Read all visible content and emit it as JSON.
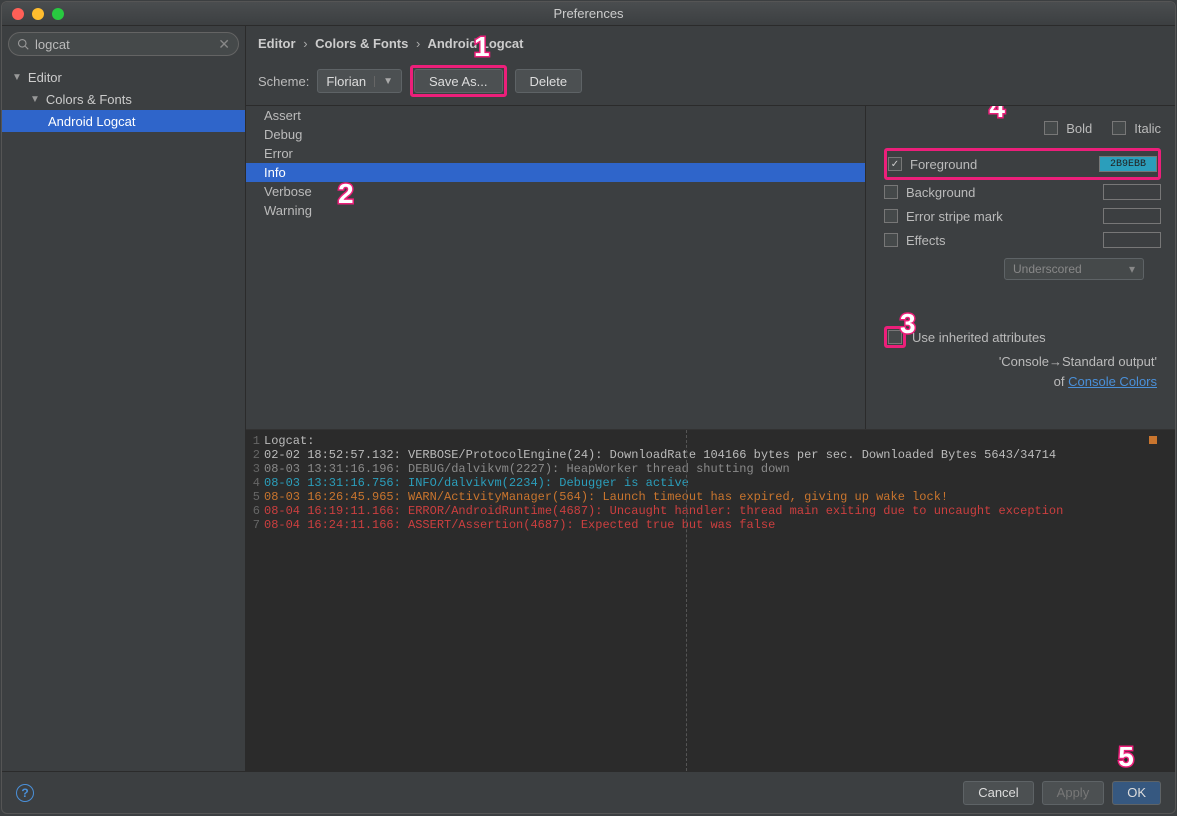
{
  "window": {
    "title": "Preferences"
  },
  "search": {
    "value": "logcat"
  },
  "tree": {
    "root": "Editor",
    "group": "Colors & Fonts",
    "selected": "Android Logcat"
  },
  "breadcrumb": {
    "p0": "Editor",
    "p1": "Colors & Fonts",
    "p2": "Android Logcat"
  },
  "scheme": {
    "label": "Scheme:",
    "value": "Florian",
    "saveas": "Save As...",
    "delete": "Delete"
  },
  "levels": [
    "Assert",
    "Debug",
    "Error",
    "Info",
    "Verbose",
    "Warning"
  ],
  "levels_selected": "Info",
  "attrs": {
    "bold": "Bold",
    "italic": "Italic",
    "fg": "Foreground",
    "fg_hex": "2B9EBB",
    "bg": "Background",
    "stripe": "Error stripe mark",
    "effects": "Effects",
    "effects_kind": "Underscored",
    "inherit": "Use inherited attributes",
    "inherit_from_1": "'Console→Standard output'",
    "inherit_from_2": "of ",
    "inherit_link": "Console Colors"
  },
  "preview": {
    "header": "Logcat:",
    "lines": {
      "l2": "02-02 18:52:57.132: VERBOSE/ProtocolEngine(24): DownloadRate 104166 bytes per sec. Downloaded Bytes 5643/34714",
      "l3": "08-03 13:31:16.196: DEBUG/dalvikvm(2227): HeapWorker thread shutting down",
      "l4": "08-03 13:31:16.756: INFO/dalvikvm(2234): Debugger is active",
      "l5": "08-03 16:26:45.965: WARN/ActivityManager(564): Launch timeout has expired, giving up wake lock!",
      "l6": "08-04 16:19:11.166: ERROR/AndroidRuntime(4687): Uncaught handler: thread main exiting due to uncaught exception",
      "l7": "08-04 16:24:11.166: ASSERT/Assertion(4687): Expected true but was false"
    }
  },
  "footer": {
    "cancel": "Cancel",
    "apply": "Apply",
    "ok": "OK"
  },
  "callouts": {
    "c1": "1",
    "c2": "2",
    "c3": "3",
    "c4": "4",
    "c5": "5"
  }
}
